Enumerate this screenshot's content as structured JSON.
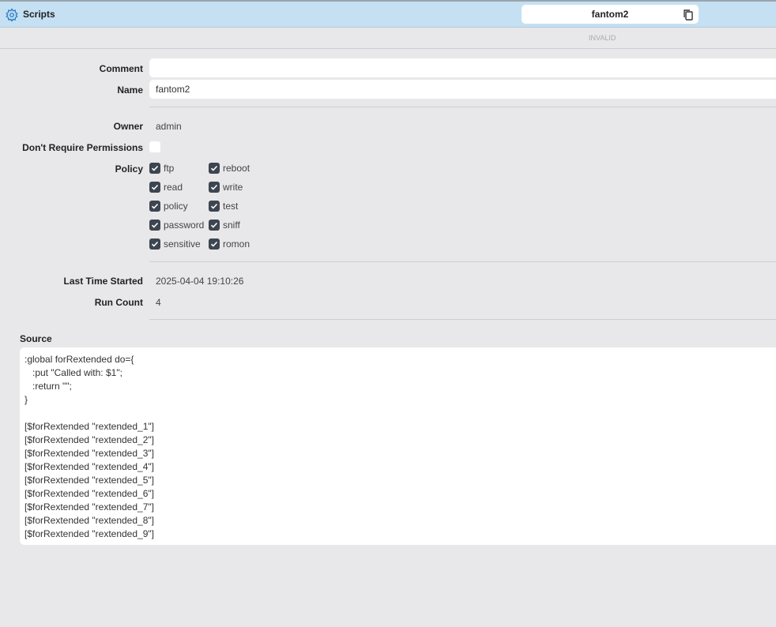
{
  "header": {
    "title": "Scripts",
    "record_name": "fantom2",
    "status": "INVALID"
  },
  "form": {
    "comment_label": "Comment",
    "comment_value": "",
    "name_label": "Name",
    "name_value": "fantom2",
    "owner_label": "Owner",
    "owner_value": "admin",
    "dont_require_label": "Don't Require Permissions",
    "dont_require_checked": false,
    "policy_label": "Policy",
    "policies": [
      {
        "label": "ftp",
        "checked": true
      },
      {
        "label": "reboot",
        "checked": true
      },
      {
        "label": "read",
        "checked": true
      },
      {
        "label": "write",
        "checked": true
      },
      {
        "label": "policy",
        "checked": true
      },
      {
        "label": "test",
        "checked": true
      },
      {
        "label": "password",
        "checked": true
      },
      {
        "label": "sniff",
        "checked": true
      },
      {
        "label": "sensitive",
        "checked": true
      },
      {
        "label": "romon",
        "checked": true
      }
    ],
    "last_started_label": "Last Time Started",
    "last_started_value": "2025-04-04 19:10:26",
    "run_count_label": "Run Count",
    "run_count_value": "4",
    "source_label": "Source",
    "source": ":global forRextended do={\n   :put \"Called with: $1\";\n   :return \"\";\n}\n\n[$forRextended \"rextended_1\"]\n[$forRextended \"rextended_2\"]\n[$forRextended \"rextended_3\"]\n[$forRextended \"rextended_4\"]\n[$forRextended \"rextended_5\"]\n[$forRextended \"rextended_6\"]\n[$forRextended \"rextended_7\"]\n[$forRextended \"rextended_8\"]\n[$forRextended \"rextended_9\"]"
  }
}
